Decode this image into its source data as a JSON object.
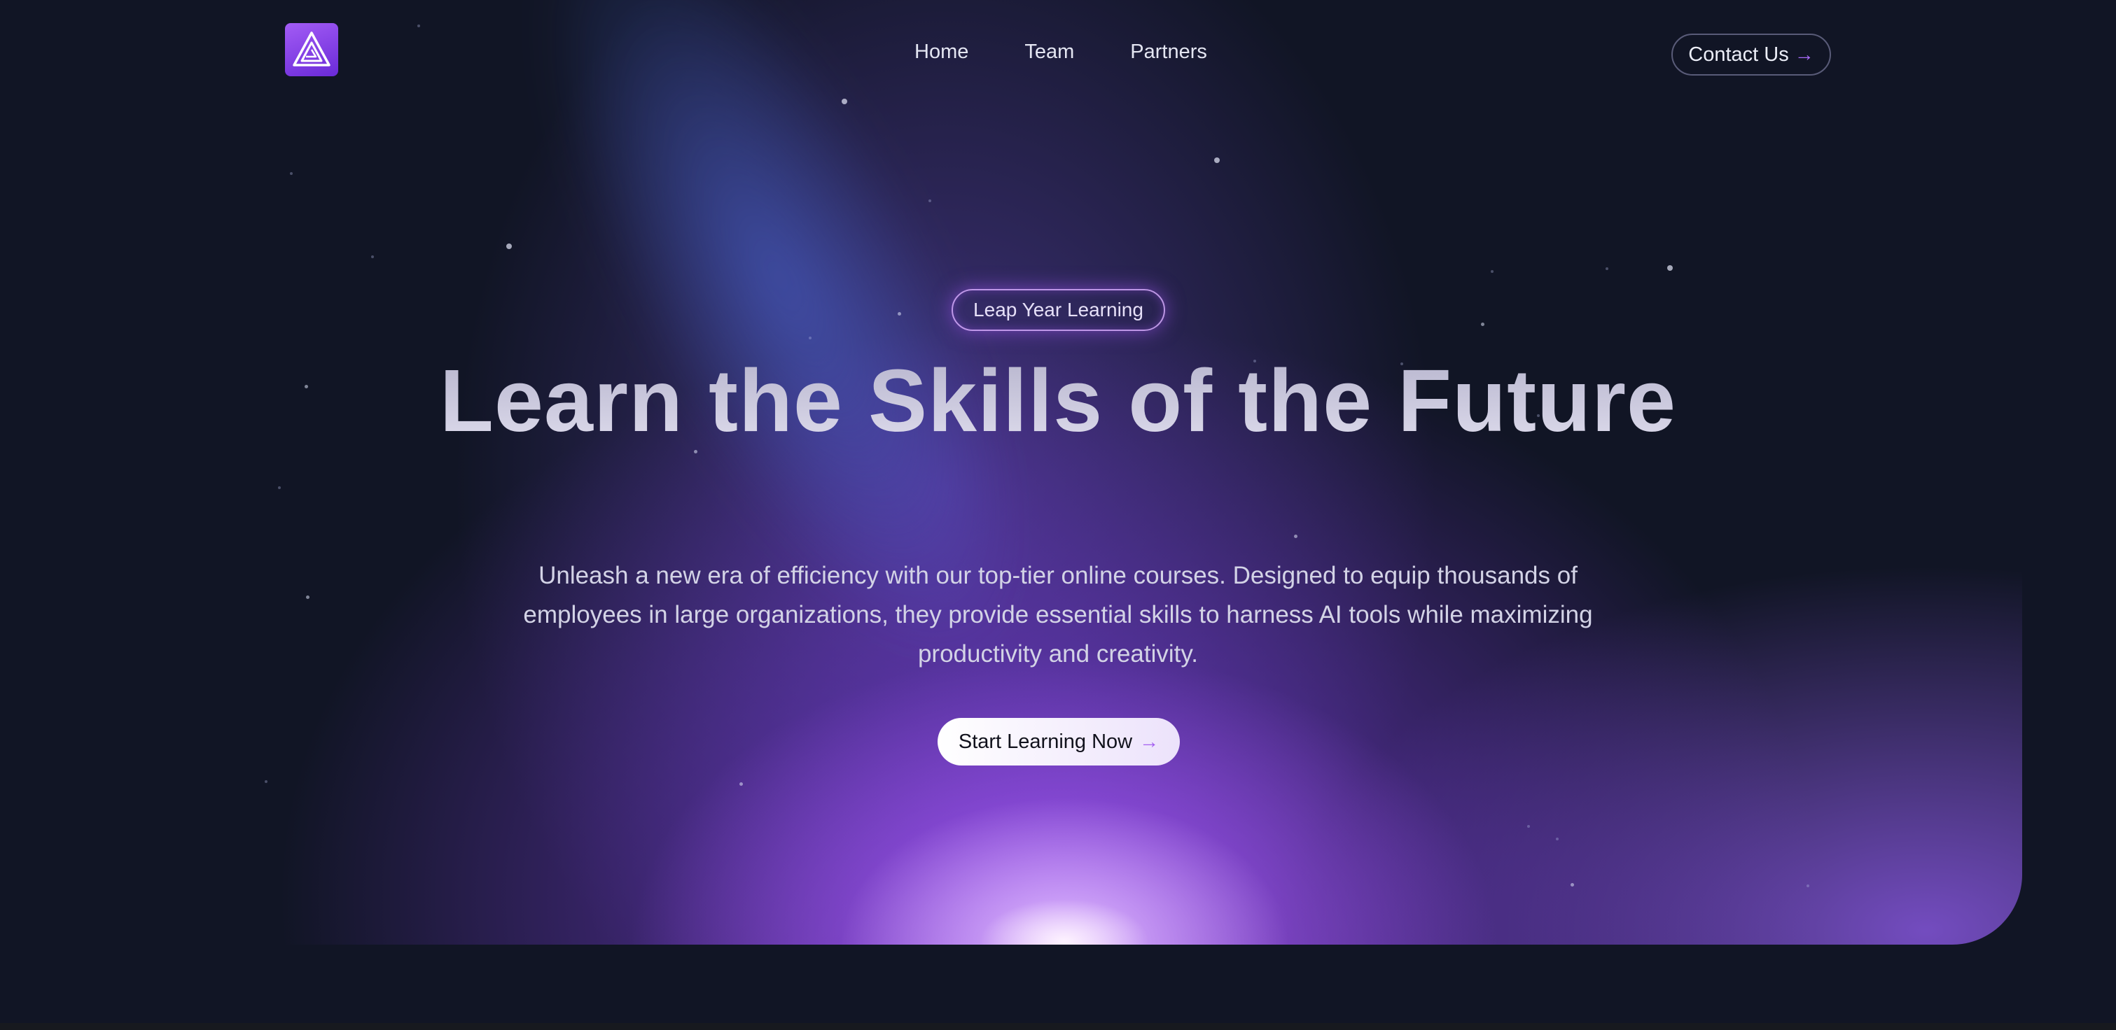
{
  "nav": {
    "logo_icon": "triangle-logo-icon",
    "links": [
      "Home",
      "Team",
      "Partners"
    ],
    "contact_label": "Contact Us",
    "arrow": "→"
  },
  "hero": {
    "badge": "Leap Year Learning",
    "headline": "Learn the Skills of the Future",
    "subtext": "Unleash a new era of efficiency with our top-tier online courses. Designed to equip thousands of employees in large organizations, they provide essential skills to harness AI tools while maximizing productivity and creativity.",
    "cta_label": "Start Learning Now",
    "cta_arrow": "→"
  },
  "colors": {
    "background": "#111525",
    "accent": "#a35cf5",
    "glow": "#9b59f0"
  }
}
